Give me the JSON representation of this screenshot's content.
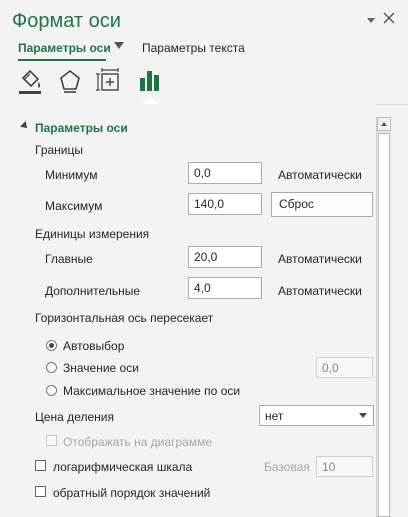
{
  "pane": {
    "title": "Формат оси",
    "tabs": [
      {
        "label": "Параметры оси"
      },
      {
        "label": "Параметры текста"
      }
    ]
  },
  "icons": [
    "fill-line-icon",
    "effects-pentagon-icon",
    "size-properties-icon",
    "axis-options-chart-icon"
  ],
  "section": {
    "title": "Параметры оси",
    "bounds": {
      "label": "Границы",
      "min_label": "Минимум",
      "min_value": "0,0",
      "min_status": "Автоматически",
      "max_label": "Максимум",
      "max_value": "140,0",
      "max_reset": "Сброс"
    },
    "units": {
      "label": "Единицы измерения",
      "major_label": "Главные",
      "major_value": "20,0",
      "major_status": "Автоматически",
      "minor_label": "Дополнительные",
      "minor_value": "4,0",
      "minor_status": "Автоматически"
    },
    "cross": {
      "label": "Горизонтальная ось пересекает",
      "auto_label": "Автовыбор",
      "value_label": "Значение оси",
      "value_input": "0,0",
      "max_label": "Максимальное значение по оси"
    },
    "display_units": {
      "label": "Цена деления",
      "value": "нет",
      "show_label": "Отображать на диаграмме"
    },
    "log_scale": {
      "label": "логарифмическая шкала",
      "base_label": "Базовая",
      "base_value": "10"
    },
    "reverse": {
      "label": "обратный порядок значений"
    }
  },
  "colors": {
    "accent": "#217346",
    "background": "#f3f3f3"
  }
}
